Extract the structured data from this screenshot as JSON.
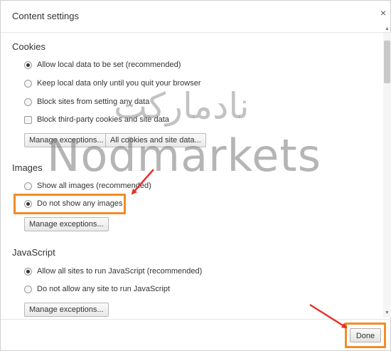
{
  "dialog": {
    "title": "Content settings",
    "close_label": "×",
    "done_label": "Done"
  },
  "cookies": {
    "title": "Cookies",
    "options": [
      {
        "label": "Allow local data to be set (recommended)",
        "selected": true
      },
      {
        "label": "Keep local data only until you quit your browser",
        "selected": false
      },
      {
        "label": "Block sites from setting any data",
        "selected": false
      }
    ],
    "checkbox_label": "Block third-party cookies and site data",
    "manage_label": "Manage exceptions...",
    "all_cookies_label": "All cookies and site data..."
  },
  "images": {
    "title": "Images",
    "options": [
      {
        "label": "Show all images (recommended)",
        "selected": false
      },
      {
        "label": "Do not show any images",
        "selected": true
      }
    ],
    "manage_label": "Manage exceptions..."
  },
  "javascript": {
    "title": "JavaScript",
    "options": [
      {
        "label": "Allow all sites to run JavaScript (recommended)",
        "selected": true
      },
      {
        "label": "Do not allow any site to run JavaScript",
        "selected": false
      }
    ],
    "manage_label": "Manage exceptions..."
  },
  "watermark": {
    "english": "Nodmarkets",
    "persian": "نادمارکت"
  },
  "colors": {
    "highlight": "#f28c28",
    "arrow": "#e8302a"
  }
}
